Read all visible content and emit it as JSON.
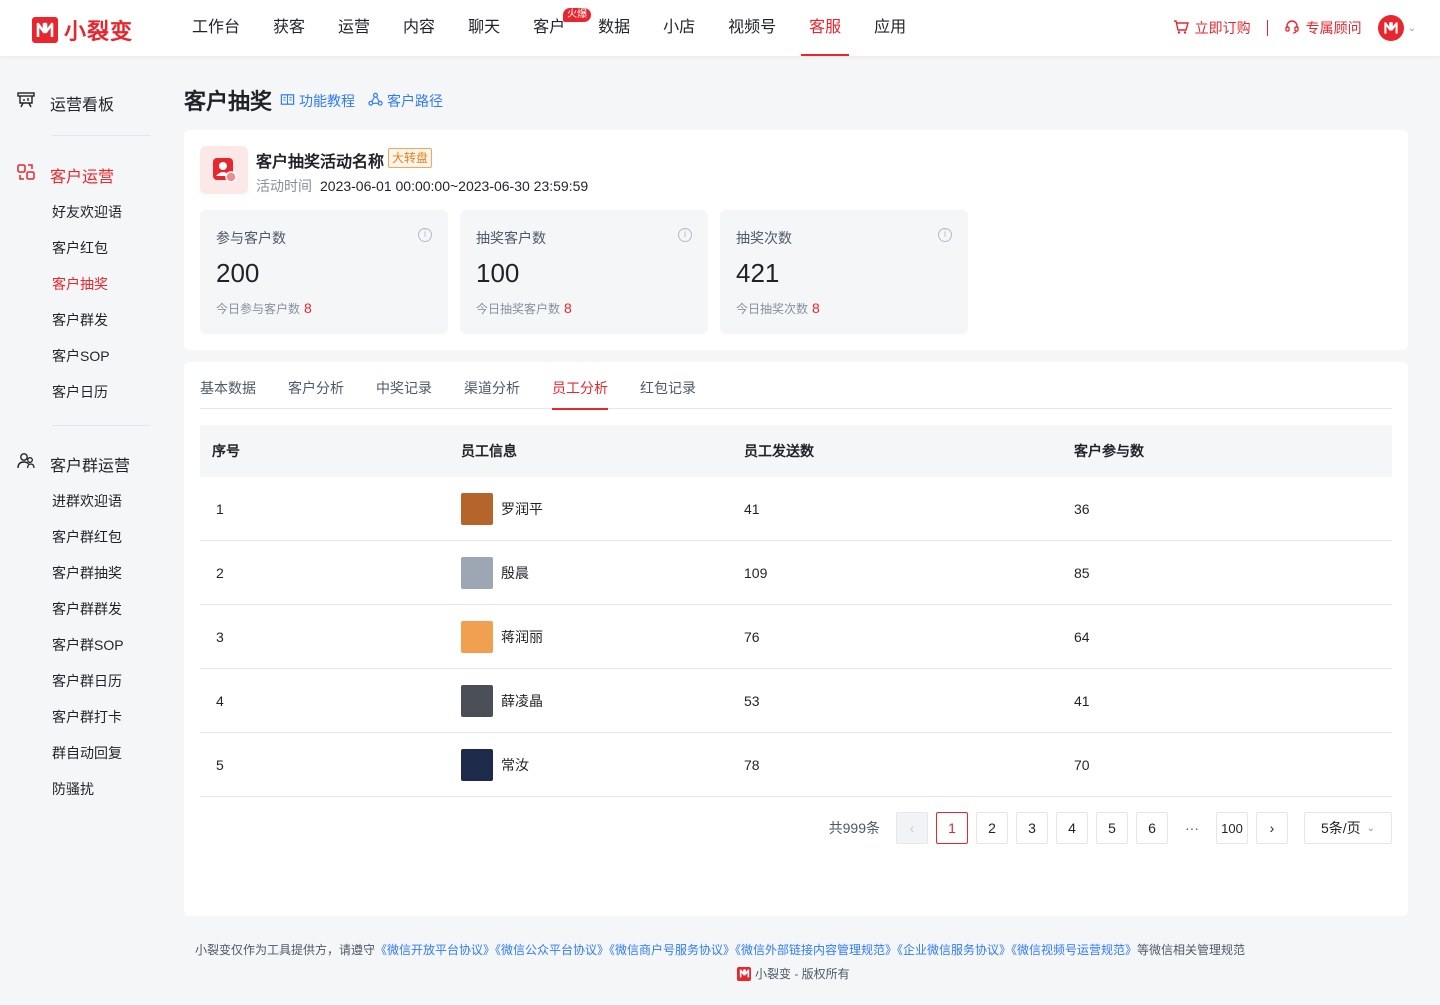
{
  "brand": {
    "name": "小裂变"
  },
  "nav": {
    "items": [
      "工作台",
      "获客",
      "运营",
      "内容",
      "聊天",
      "客户",
      "数据",
      "小店",
      "视频号",
      "客服",
      "应用"
    ],
    "hot_badge": "火爆",
    "active": "客服",
    "order_label": "立即订购",
    "consultant_label": "专属顾问"
  },
  "sidebar": {
    "dashboard": "运营看板",
    "group1": {
      "title": "客户运营",
      "items": [
        "好友欢迎语",
        "客户红包",
        "客户抽奖",
        "客户群发",
        "客户SOP",
        "客户日历"
      ]
    },
    "group2": {
      "title": "客户群运营",
      "items": [
        "进群欢迎语",
        "客户群红包",
        "客户群抽奖",
        "客户群群发",
        "客户群SOP",
        "客户群日历",
        "客户群打卡",
        "群自动回复",
        "防骚扰"
      ]
    },
    "active_item": "客户抽奖"
  },
  "page": {
    "title": "客户抽奖",
    "tutorial_link": "功能教程",
    "path_link": "客户路径"
  },
  "activity": {
    "name": "客户抽奖活动名称",
    "tag": "大转盘",
    "time_label": "活动时间",
    "time_value": "2023-06-01 00:00:00~2023-06-30 23:59:59"
  },
  "stats": [
    {
      "label": "参与客户数",
      "value": "200",
      "today_label": "今日参与客户数",
      "today_value": "8"
    },
    {
      "label": "抽奖客户数",
      "value": "100",
      "today_label": "今日抽奖客户数",
      "today_value": "8"
    },
    {
      "label": "抽奖次数",
      "value": "421",
      "today_label": "今日抽奖次数",
      "today_value": "8"
    }
  ],
  "tabs": [
    "基本数据",
    "客户分析",
    "中奖记录",
    "渠道分析",
    "员工分析",
    "红包记录"
  ],
  "active_tab": "员工分析",
  "table": {
    "headers": [
      "序号",
      "员工信息",
      "员工发送数",
      "客户参与数"
    ],
    "rows": [
      {
        "no": "1",
        "name": "罗润平",
        "sent": "41",
        "joined": "36",
        "avatar_color": "#b5652c"
      },
      {
        "no": "2",
        "name": "殷晨",
        "sent": "109",
        "joined": "85",
        "avatar_color": "#9ca7b3"
      },
      {
        "no": "3",
        "name": "蒋润丽",
        "sent": "76",
        "joined": "64",
        "avatar_color": "#f0a050"
      },
      {
        "no": "4",
        "name": "薛凌晶",
        "sent": "53",
        "joined": "41",
        "avatar_color": "#4a4f57"
      },
      {
        "no": "5",
        "name": "常汝",
        "sent": "78",
        "joined": "70",
        "avatar_color": "#1d2a4a"
      }
    ]
  },
  "pagination": {
    "total": "共999条",
    "pages": [
      "1",
      "2",
      "3",
      "4",
      "5",
      "6"
    ],
    "ellipsis": "···",
    "last_page": "100",
    "page_size": "5条/页"
  },
  "footer": {
    "prefix": "小裂变仅作为工具提供方，请遵守",
    "links": [
      "《微信开放平台协议》",
      "《微信公众平台协议》",
      "《微信商户号服务协议》",
      "《微信外部链接内容管理规范》",
      "《企业微信服务协议》",
      "《微信视频号运营规范》"
    ],
    "suffix": "等微信相关管理规范",
    "copyright": "小裂变 - 版权所有"
  },
  "colors": {
    "accent": "#e8262e",
    "link": "#2f7cf6"
  }
}
